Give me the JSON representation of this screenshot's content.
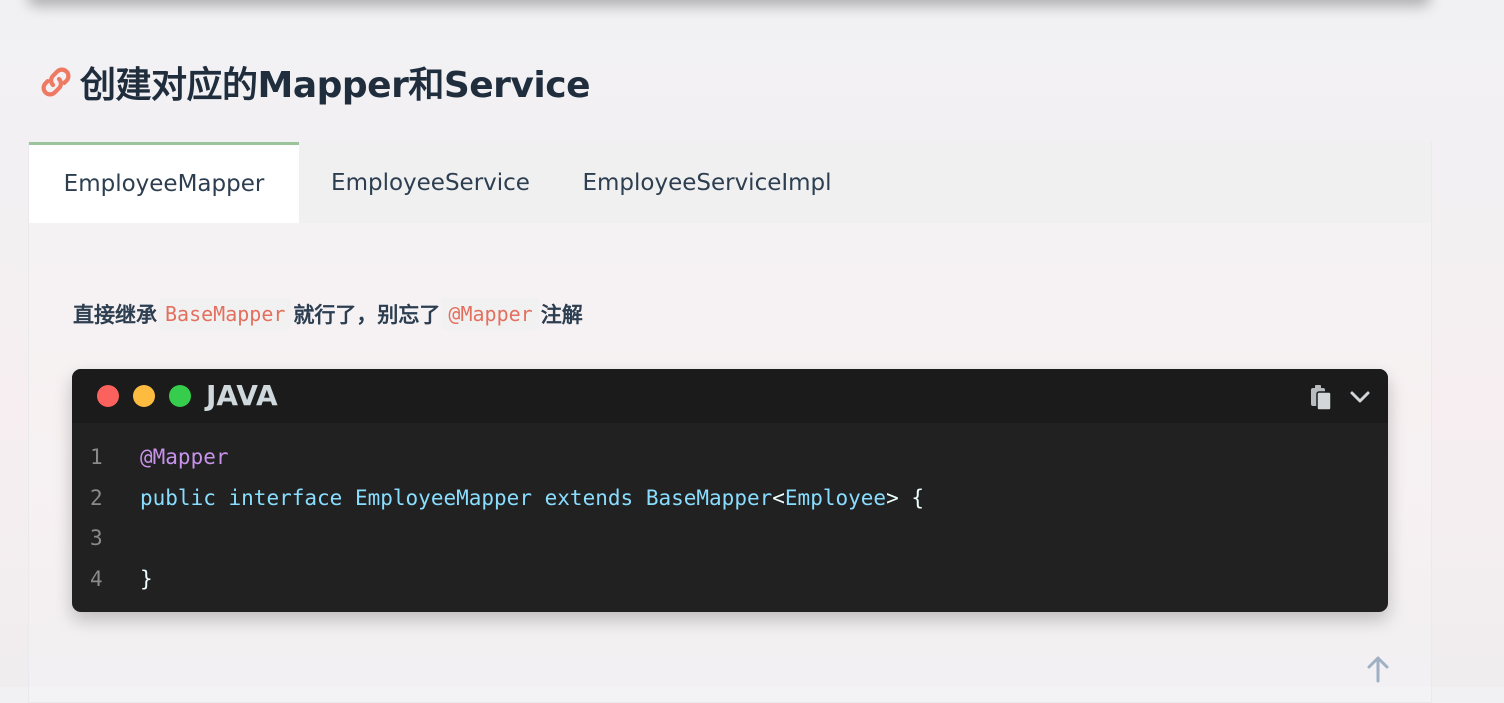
{
  "heading": {
    "icon": "link-icon",
    "title": "创建对应的Mapper和Service"
  },
  "tabs": [
    {
      "label": "EmployeeMapper",
      "active": true
    },
    {
      "label": "EmployeeService",
      "active": false
    },
    {
      "label": "EmployeeServiceImpl",
      "active": false
    }
  ],
  "description": {
    "part1": "直接继承",
    "code1": "BaseMapper",
    "part2": "就行了，别忘了",
    "code2": "@Mapper",
    "part3": "注解"
  },
  "code_block": {
    "language": "JAVA",
    "window_dots": [
      "#fc625d",
      "#fdbc40",
      "#35cd4b"
    ],
    "copy_icon": "copy-icon",
    "expand_icon": "chevron-down-icon",
    "lines": [
      {
        "number": "1",
        "tokens": [
          {
            "text": "@Mapper",
            "kind": "anno"
          }
        ]
      },
      {
        "number": "2",
        "tokens": [
          {
            "text": "public",
            "kind": "kw"
          },
          {
            "text": " ",
            "kind": "plain"
          },
          {
            "text": "interface",
            "kind": "kw"
          },
          {
            "text": " ",
            "kind": "plain"
          },
          {
            "text": "EmployeeMapper",
            "kind": "cls"
          },
          {
            "text": " ",
            "kind": "plain"
          },
          {
            "text": "extends",
            "kind": "kw"
          },
          {
            "text": " ",
            "kind": "plain"
          },
          {
            "text": "BaseMapper",
            "kind": "cls"
          },
          {
            "text": "<",
            "kind": "plain"
          },
          {
            "text": "Employee",
            "kind": "cls"
          },
          {
            "text": "> {",
            "kind": "plain"
          }
        ]
      },
      {
        "number": "3",
        "tokens": []
      },
      {
        "number": "4",
        "tokens": [
          {
            "text": "}",
            "kind": "plain"
          }
        ]
      }
    ]
  },
  "colors": {
    "active_tab_border": "#9bc49b",
    "heading_text": "#1f2d3d",
    "inline_code": "#e3705f"
  },
  "scroll_icon": "arrow-up-icon"
}
